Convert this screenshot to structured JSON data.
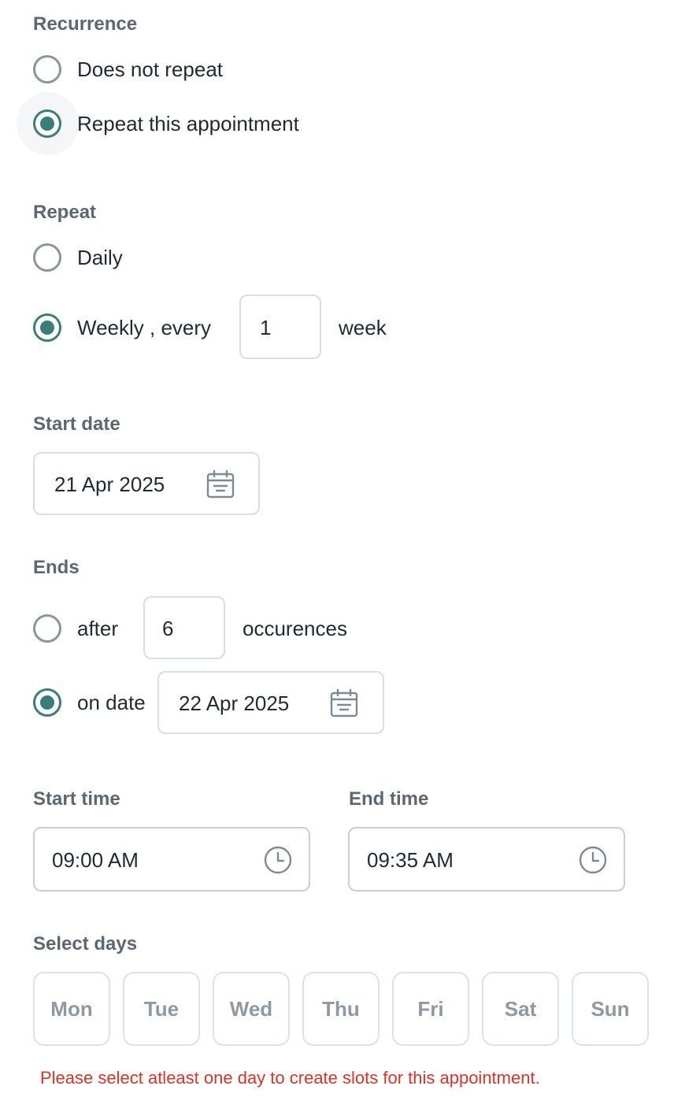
{
  "recurrence": {
    "label": "Recurrence",
    "options": [
      {
        "label": "Does not repeat",
        "selected": false
      },
      {
        "label": "Repeat this appointment",
        "selected": true
      }
    ]
  },
  "repeat": {
    "label": "Repeat",
    "daily_label": "Daily",
    "daily_selected": false,
    "weekly_label": "Weekly , every",
    "weekly_selected": true,
    "weekly_interval": "1",
    "weekly_unit": "week"
  },
  "start_date": {
    "label": "Start date",
    "value": "21 Apr 2025",
    "icon": "calendar-icon"
  },
  "ends": {
    "label": "Ends",
    "after_label": "after",
    "after_selected": false,
    "occurrences_value": "6",
    "occurrences_unit": "occurences",
    "on_date_label": "on date",
    "on_date_selected": true,
    "on_date_value": "22 Apr 2025",
    "icon": "calendar-icon"
  },
  "start_time": {
    "label": "Start time",
    "value": "09:00 AM",
    "icon": "clock-icon"
  },
  "end_time": {
    "label": "End time",
    "value": "09:35 AM",
    "icon": "clock-icon"
  },
  "days": {
    "label": "Select days",
    "items": [
      "Mon",
      "Tue",
      "Wed",
      "Thu",
      "Fri",
      "Sat",
      "Sun"
    ]
  },
  "error": "Please select atleast one day to create slots for this appointment.",
  "colors": {
    "accent": "#3b7d79",
    "label": "#5b6773",
    "error": "#e03127",
    "border": "#d9dee3"
  }
}
